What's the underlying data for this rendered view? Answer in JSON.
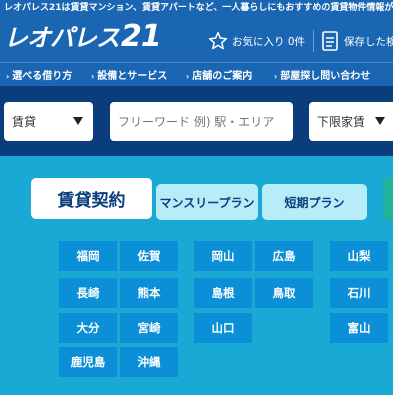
{
  "header": {
    "tagline": "レオパレス21は賃貸マンション、賃貸アパートなど、一人暮らしにもおすすめの賃貸物件情報が満",
    "logo_text": "レオパレス",
    "logo_number": "21",
    "favorites_label": "お気に入り 0件",
    "saved_label": "保存した検"
  },
  "nav": {
    "items": [
      "選べる借り方",
      "設備とサービス",
      "店舗のご案内",
      "部屋探し問い合わせ"
    ]
  },
  "search": {
    "type_value": "賃貸",
    "freeword_placeholder": "フリーワード 例) 駅・エリア",
    "rent_min_value": "下限家賃"
  },
  "tabs": {
    "main": "賃貸契約",
    "monthly": "マンスリープラン",
    "short_term": "短期プラン"
  },
  "prefectures": {
    "col1": [
      "福岡",
      "長崎",
      "大分",
      "鹿児島"
    ],
    "col2": [
      "佐賀",
      "熊本",
      "宮崎",
      "沖縄"
    ],
    "col3": [
      "岡山",
      "島根",
      "山口"
    ],
    "col4": [
      "広島",
      "鳥取"
    ],
    "col5": [
      "山梨",
      "石川",
      "富山"
    ]
  },
  "colors": {
    "header_blue": "#1a66b3",
    "search_navy": "#0b3d7c",
    "main_cyan": "#1aa8d4",
    "pref_button": "#0b8fd6",
    "tab_light": "#b7ecf9"
  }
}
